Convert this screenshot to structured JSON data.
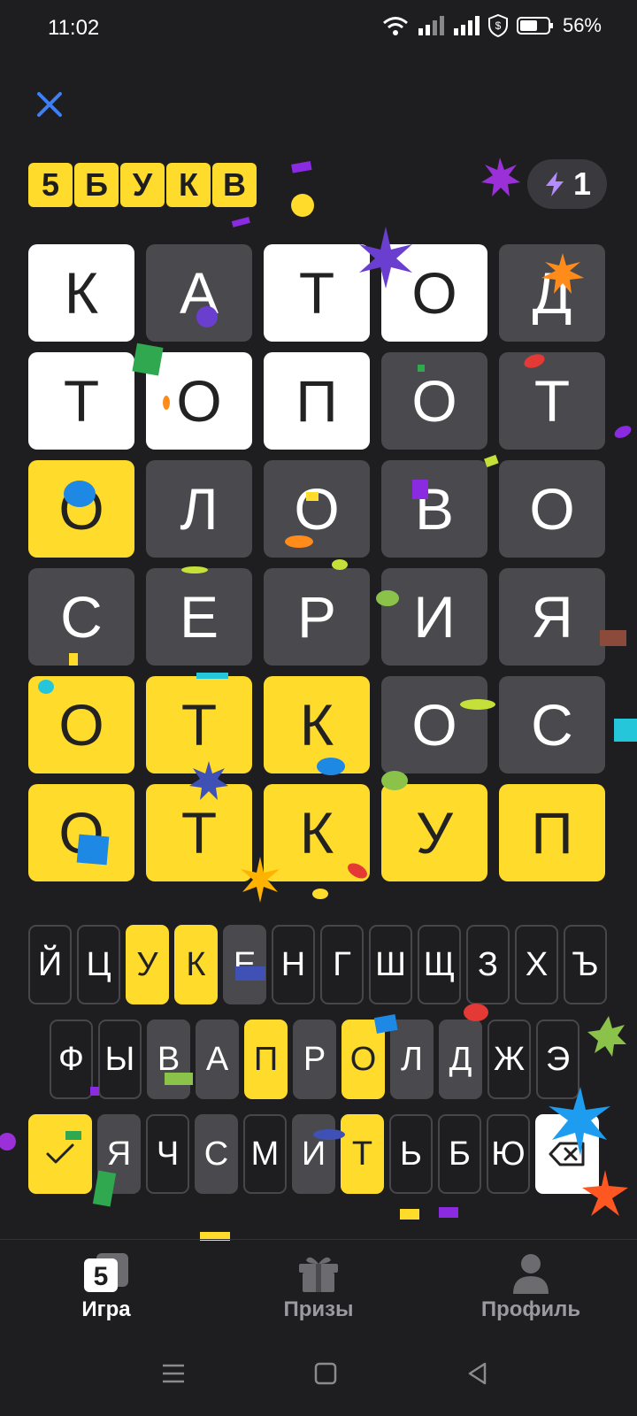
{
  "status_bar": {
    "time": "11:02",
    "battery": "56%"
  },
  "header": {
    "logo_letters": [
      "5",
      "Б",
      "У",
      "К",
      "В"
    ],
    "hint_count": "1"
  },
  "board": {
    "rows": [
      [
        {
          "l": "К",
          "s": "white"
        },
        {
          "l": "А",
          "s": "gray"
        },
        {
          "l": "Т",
          "s": "white"
        },
        {
          "l": "О",
          "s": "white"
        },
        {
          "l": "Д",
          "s": "gray"
        }
      ],
      [
        {
          "l": "Т",
          "s": "white"
        },
        {
          "l": "О",
          "s": "white"
        },
        {
          "l": "П",
          "s": "white"
        },
        {
          "l": "О",
          "s": "gray"
        },
        {
          "l": "Т",
          "s": "gray"
        }
      ],
      [
        {
          "l": "О",
          "s": "yellow"
        },
        {
          "l": "Л",
          "s": "gray"
        },
        {
          "l": "О",
          "s": "gray"
        },
        {
          "l": "В",
          "s": "gray"
        },
        {
          "l": "О",
          "s": "gray"
        }
      ],
      [
        {
          "l": "С",
          "s": "gray"
        },
        {
          "l": "Е",
          "s": "gray"
        },
        {
          "l": "Р",
          "s": "gray"
        },
        {
          "l": "И",
          "s": "gray"
        },
        {
          "l": "Я",
          "s": "gray"
        }
      ],
      [
        {
          "l": "О",
          "s": "yellow"
        },
        {
          "l": "Т",
          "s": "yellow"
        },
        {
          "l": "К",
          "s": "yellow"
        },
        {
          "l": "О",
          "s": "gray"
        },
        {
          "l": "С",
          "s": "gray"
        }
      ],
      [
        {
          "l": "О",
          "s": "yellow"
        },
        {
          "l": "Т",
          "s": "yellow"
        },
        {
          "l": "К",
          "s": "yellow"
        },
        {
          "l": "У",
          "s": "yellow"
        },
        {
          "l": "П",
          "s": "yellow"
        }
      ]
    ]
  },
  "keyboard": {
    "rows": [
      [
        {
          "l": "Й",
          "s": "none"
        },
        {
          "l": "Ц",
          "s": "none"
        },
        {
          "l": "У",
          "s": "yellow"
        },
        {
          "l": "К",
          "s": "yellow"
        },
        {
          "l": "Е",
          "s": "gray"
        },
        {
          "l": "Н",
          "s": "none"
        },
        {
          "l": "Г",
          "s": "none"
        },
        {
          "l": "Ш",
          "s": "none"
        },
        {
          "l": "Щ",
          "s": "none"
        },
        {
          "l": "З",
          "s": "none"
        },
        {
          "l": "Х",
          "s": "none"
        },
        {
          "l": "Ъ",
          "s": "none"
        }
      ],
      [
        {
          "l": "Ф",
          "s": "none"
        },
        {
          "l": "Ы",
          "s": "none"
        },
        {
          "l": "В",
          "s": "gray"
        },
        {
          "l": "А",
          "s": "gray"
        },
        {
          "l": "П",
          "s": "yellow"
        },
        {
          "l": "Р",
          "s": "gray"
        },
        {
          "l": "О",
          "s": "yellow"
        },
        {
          "l": "Л",
          "s": "gray"
        },
        {
          "l": "Д",
          "s": "gray"
        },
        {
          "l": "Ж",
          "s": "none"
        },
        {
          "l": "Э",
          "s": "none"
        }
      ],
      [
        {
          "l": "Я",
          "s": "gray"
        },
        {
          "l": "Ч",
          "s": "none"
        },
        {
          "l": "С",
          "s": "gray"
        },
        {
          "l": "М",
          "s": "none"
        },
        {
          "l": "И",
          "s": "gray"
        },
        {
          "l": "Т",
          "s": "yellow"
        },
        {
          "l": "Ь",
          "s": "none"
        },
        {
          "l": "Б",
          "s": "none"
        },
        {
          "l": "Ю",
          "s": "none"
        }
      ]
    ],
    "enter_icon": "checkmark-icon",
    "backspace_icon": "backspace-icon"
  },
  "tabbar": {
    "tabs": [
      {
        "label": "Игра",
        "icon": "game-5-icon",
        "active": true
      },
      {
        "label": "Призы",
        "icon": "gift-icon",
        "active": false
      },
      {
        "label": "Профиль",
        "icon": "profile-icon",
        "active": false
      }
    ]
  },
  "colors": {
    "background": "#1e1e20",
    "yellow": "#ffdb2c",
    "gray_tile": "#4a4a4e",
    "white_tile": "#ffffff",
    "close_blue": "#3d7ff5"
  }
}
